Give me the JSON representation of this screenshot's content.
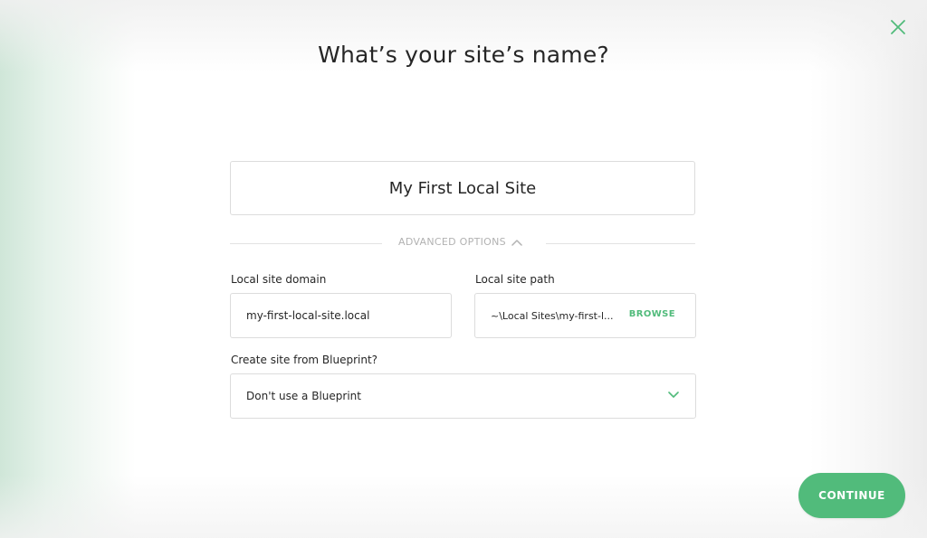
{
  "dialog": {
    "title": "What’s your site’s name?",
    "close_icon": "close-icon"
  },
  "site_name": {
    "value": "My First Local Site"
  },
  "advanced": {
    "label": "ADVANCED OPTIONS",
    "toggle_icon": "chevron-up-icon",
    "expanded": true
  },
  "domain": {
    "label": "Local site domain",
    "value": "my-first-local-site.local"
  },
  "path": {
    "label": "Local site path",
    "value": "~\\Local Sites\\my-first-l...",
    "browse_label": "BROWSE"
  },
  "blueprint": {
    "label": "Create site from Blueprint?",
    "selected": "Don't use a Blueprint",
    "chevron_icon": "chevron-down-icon"
  },
  "footer": {
    "continue_label": "CONTINUE"
  },
  "colors": {
    "accent": "#51bb7b",
    "text": "#262626",
    "muted": "#b2b2b2",
    "border": "#dcdcdc"
  }
}
